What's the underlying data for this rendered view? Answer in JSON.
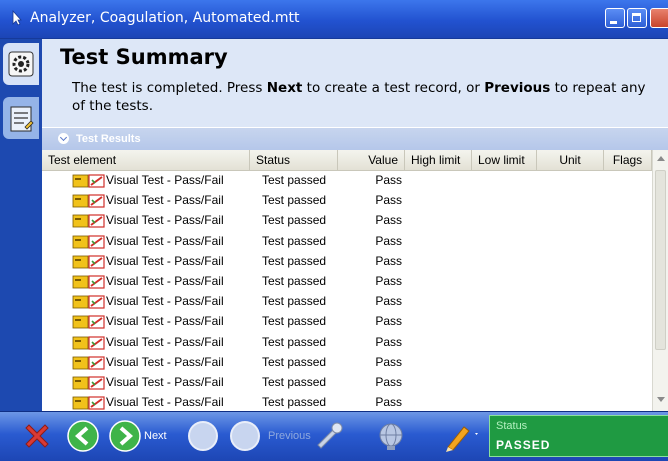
{
  "window": {
    "title": "Analyzer, Coagulation, Automated.mtt"
  },
  "header": {
    "page_title": "Test Summary",
    "instruction": [
      {
        "text": "The test is completed. Press ",
        "bold": false
      },
      {
        "text": "Next",
        "bold": true
      },
      {
        "text": " to create a test record, or ",
        "bold": false
      },
      {
        "text": "Previous",
        "bold": true
      },
      {
        "text": " to repeat any of the tests.",
        "bold": false
      }
    ]
  },
  "section": {
    "title": "Test Results"
  },
  "table": {
    "columns": [
      "Test element",
      "Status",
      "Value",
      "High limit",
      "Low limit",
      "Unit",
      "Flags"
    ],
    "rows": [
      {
        "element": "Visual Test - Pass/Fail",
        "status": "Test passed",
        "value": "Pass"
      },
      {
        "element": "Visual Test - Pass/Fail",
        "status": "Test passed",
        "value": "Pass"
      },
      {
        "element": "Visual Test - Pass/Fail",
        "status": "Test passed",
        "value": "Pass"
      },
      {
        "element": "Visual Test - Pass/Fail",
        "status": "Test passed",
        "value": "Pass"
      },
      {
        "element": "Visual Test - Pass/Fail",
        "status": "Test passed",
        "value": "Pass"
      },
      {
        "element": "Visual Test - Pass/Fail",
        "status": "Test passed",
        "value": "Pass"
      },
      {
        "element": "Visual Test - Pass/Fail",
        "status": "Test passed",
        "value": "Pass"
      },
      {
        "element": "Visual Test - Pass/Fail",
        "status": "Test passed",
        "value": "Pass"
      },
      {
        "element": "Visual Test - Pass/Fail",
        "status": "Test passed",
        "value": "Pass"
      },
      {
        "element": "Visual Test - Pass/Fail",
        "status": "Test passed",
        "value": "Pass"
      },
      {
        "element": "Visual Test - Pass/Fail",
        "status": "Test passed",
        "value": "Pass"
      },
      {
        "element": "Visual Test - Pass/Fail",
        "status": "Test passed",
        "value": "Pass"
      }
    ]
  },
  "toolbar": {
    "next_label": "Next",
    "previous_label": "Previous",
    "icons": [
      "cancel-icon",
      "back-icon",
      "next-icon",
      "disabled-circle-icon",
      "disabled-circle-icon",
      "tools-icon",
      "globe-icon",
      "pen-icon"
    ]
  },
  "status": {
    "label": "Status",
    "value": "PASSED"
  },
  "colors": {
    "titlebar": "#2252d0",
    "header_bg": "#dde7f7",
    "toolbar": "#2a5bd1",
    "status_bg": "#1f9a42",
    "cancel": "#d93a35",
    "nav_green": "#3fb449"
  }
}
